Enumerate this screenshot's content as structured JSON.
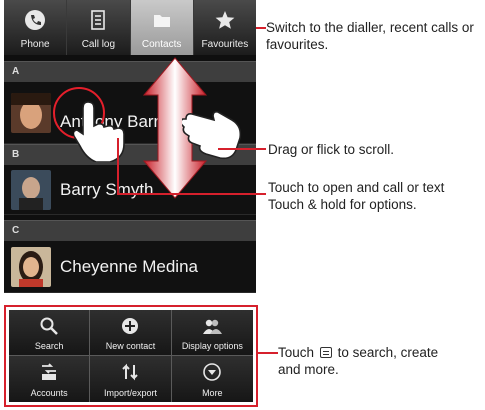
{
  "tabs": [
    {
      "label": "Phone",
      "icon": "phone-icon"
    },
    {
      "label": "Call log",
      "icon": "call-log-icon"
    },
    {
      "label": "Contacts",
      "icon": "contacts-icon",
      "active": true
    },
    {
      "label": "Favourites",
      "icon": "star-icon"
    }
  ],
  "sections": {
    "a": "A",
    "b": "B",
    "c": "C"
  },
  "contacts": [
    {
      "name": "Anthony Barr",
      "section": "A"
    },
    {
      "name": "Barry Smyth",
      "section": "B"
    },
    {
      "name": "Cheyenne Medina",
      "section": "C"
    }
  ],
  "menu": [
    {
      "label": "Search",
      "icon": "search-icon"
    },
    {
      "label": "New contact",
      "icon": "add-icon"
    },
    {
      "label": "Display options",
      "icon": "people-icon"
    },
    {
      "label": "Accounts",
      "icon": "accounts-icon"
    },
    {
      "label": "Import/export",
      "icon": "import-export-icon"
    },
    {
      "label": "More",
      "icon": "more-icon"
    }
  ],
  "callouts": {
    "tabs": "Switch to the dialler, recent calls or favourites.",
    "scroll": "Drag or flick to scroll.",
    "open_line1": "Touch to open and call or text",
    "open_line2": "Touch & hold for options.",
    "menu_pre": "Touch",
    "menu_post": "to search, create",
    "menu_line2": "and more."
  },
  "colors": {
    "accent_red": "#d6202c",
    "active_tab": "#b0b0b0"
  }
}
